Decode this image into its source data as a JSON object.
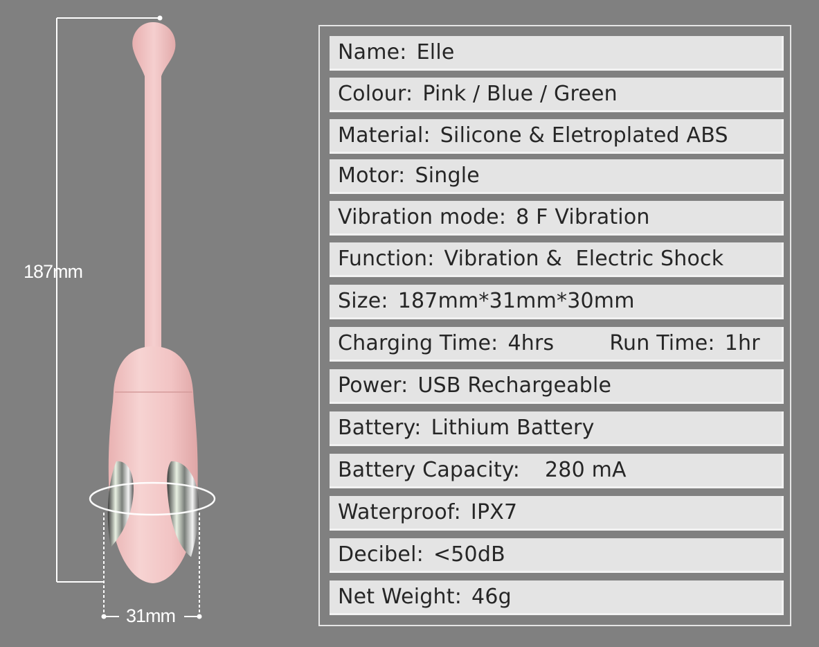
{
  "dimensions": {
    "length": "187mm",
    "width": "31mm"
  },
  "colors": {
    "background": "#808080",
    "row_background": "#e4e4e4",
    "text": "#262626",
    "product_pink": "#f1c6c6"
  },
  "specs": [
    {
      "label": "Name:",
      "value": "Elle"
    },
    {
      "label": "Colour:",
      "value": "Pink / Blue / Green"
    },
    {
      "label": "Material:",
      "value": "Silicone & Eletroplated ABS"
    },
    {
      "label": "Motor:",
      "value": "Single"
    },
    {
      "label": "Vibration mode:",
      "value": "8 F Vibration"
    },
    {
      "label": "Function:",
      "value": "Vibration &  Electric Shock"
    },
    {
      "label": "Size:",
      "value": "187mm*31mm*30mm"
    },
    {
      "label": "Charging Time:",
      "value": "4hrs",
      "extra_label": "Run Time:",
      "extra_value": "1hr"
    },
    {
      "label": "Power:",
      "value": "USB Rechargeable"
    },
    {
      "label": "Battery:",
      "value": "Lithium Battery"
    },
    {
      "label": "Battery Capacity:",
      "value": "280 mA"
    },
    {
      "label": "Waterproof:",
      "value": "IPX7"
    },
    {
      "label": "Decibel:",
      "value": "<50dB"
    },
    {
      "label": "Net Weight:",
      "value": "46g"
    }
  ]
}
